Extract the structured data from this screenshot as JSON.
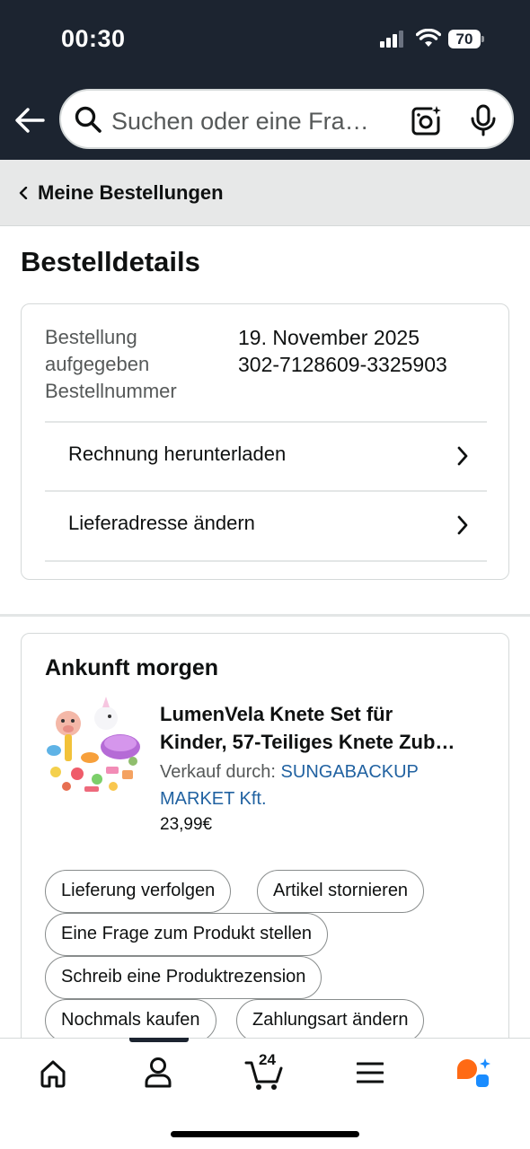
{
  "status_bar": {
    "time": "00:30",
    "battery": "70"
  },
  "search": {
    "placeholder": "Suchen oder eine Fra…"
  },
  "breadcrumb": {
    "label": "Meine Bestellungen"
  },
  "page_title": "Bestelldetails",
  "order_info": {
    "labels": [
      "Bestellung",
      "aufgegeben",
      "Bestellnummer"
    ],
    "date": "19. November 2025",
    "order_number": "302-7128609-3325903",
    "actions": [
      {
        "label": "Rechnung herunterladen"
      },
      {
        "label": "Lieferadresse ändern"
      }
    ]
  },
  "shipment": {
    "heading": "Ankunft morgen",
    "product": {
      "title_line1": "LumenVela Knete Set für",
      "title_line2": "Kinder, 57-Teiliges Knete Zub…",
      "seller_prefix": "Verkauf durch:",
      "seller_name": "SUNGABACKUP MARKET Kft.",
      "price": "23,99€"
    },
    "buttons": [
      "Lieferung verfolgen",
      "Artikel stornieren",
      "Eine Frage zum Produkt stellen",
      "Schreib eine Produktrezension",
      "Nochmals kaufen",
      "Zahlungsart ändern"
    ]
  },
  "bottom_nav": {
    "items": [
      "home-icon",
      "account-icon",
      "cart-icon",
      "menu-icon",
      "rufus-icon"
    ],
    "cart_count": "24"
  },
  "colors": {
    "header_bg": "#1c2430",
    "link": "#2162a1",
    "rufus_orange": "#ff6a14",
    "rufus_blue": "#1a8cff"
  }
}
